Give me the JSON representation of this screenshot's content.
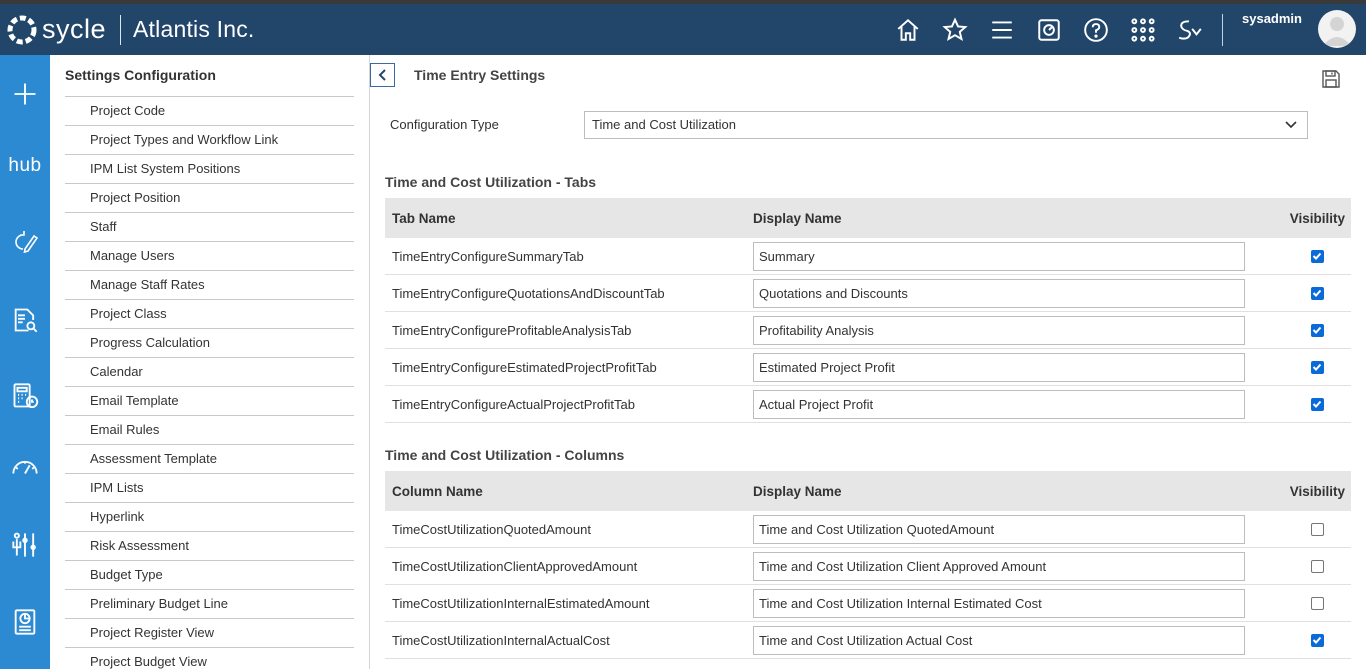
{
  "header": {
    "logo_text": "sycle",
    "company": "Atlantis Inc.",
    "username": "sysadmin",
    "icons": [
      "home-icon",
      "star-icon",
      "menu-icon",
      "dashboard-icon",
      "help-icon",
      "apps-grid-icon",
      "signature-icon"
    ]
  },
  "leftnav": {
    "hub_label": "hub",
    "icons": [
      "add-icon",
      "hub-icon",
      "edit-cycle-icon",
      "document-search-icon",
      "calculator-clock-icon",
      "gauge-icon",
      "people-settings-icon",
      "report-icon"
    ]
  },
  "settings": {
    "title": "Settings Configuration",
    "items": [
      "Project Code",
      "Project Types and Workflow Link",
      "IPM List System Positions",
      "Project Position",
      "Staff",
      "Manage Users",
      "Manage Staff Rates",
      "Project Class",
      "Progress Calculation",
      "Calendar",
      "Email Template",
      "Email Rules",
      "Assessment Template",
      "IPM Lists",
      "Hyperlink",
      "Risk Assessment",
      "Budget Type",
      "Preliminary Budget Line",
      "Project Register View",
      "Project Budget View"
    ]
  },
  "main": {
    "title": "Time Entry Settings",
    "config_label": "Configuration Type",
    "config_value": "Time and Cost Utilization",
    "tabs_section": {
      "title": "Time and Cost Utilization - Tabs",
      "headers": {
        "name": "Tab Name",
        "display": "Display Name",
        "visibility": "Visibility"
      },
      "rows": [
        {
          "name": "TimeEntryConfigureSummaryTab",
          "display": "Summary",
          "visible": true
        },
        {
          "name": "TimeEntryConfigureQuotationsAndDiscountTab",
          "display": "Quotations and Discounts",
          "visible": true
        },
        {
          "name": "TimeEntryConfigureProfitableAnalysisTab",
          "display": "Profitability Analysis",
          "visible": true
        },
        {
          "name": "TimeEntryConfigureEstimatedProjectProfitTab",
          "display": "Estimated Project Profit",
          "visible": true
        },
        {
          "name": "TimeEntryConfigureActualProjectProfitTab",
          "display": "Actual Project Profit",
          "visible": true
        }
      ]
    },
    "columns_section": {
      "title": "Time and Cost Utilization - Columns",
      "headers": {
        "name": "Column Name",
        "display": "Display Name",
        "visibility": "Visibility"
      },
      "rows": [
        {
          "name": "TimeCostUtilizationQuotedAmount",
          "display": "Time and Cost Utilization QuotedAmount",
          "visible": false
        },
        {
          "name": "TimeCostUtilizationClientApprovedAmount",
          "display": "Time and Cost Utilization Client Approved Amount",
          "visible": false
        },
        {
          "name": "TimeCostUtilizationInternalEstimatedAmount",
          "display": "Time and Cost Utilization Internal Estimated Cost",
          "visible": false
        },
        {
          "name": "TimeCostUtilizationInternalActualCost",
          "display": "Time and Cost Utilization Actual Cost",
          "visible": true
        }
      ]
    }
  },
  "colors": {
    "header_bg": "#21466a",
    "nav_bg": "#2b8ad2",
    "checkbox": "#0a6ad8"
  }
}
